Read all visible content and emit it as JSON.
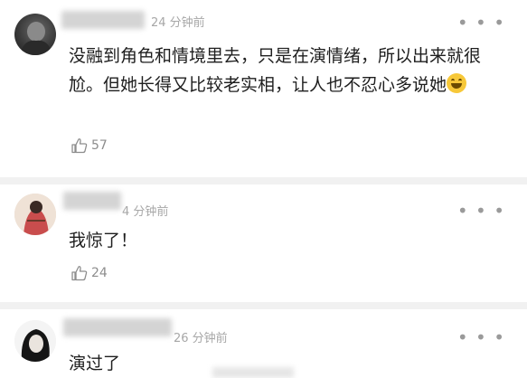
{
  "comments": [
    {
      "time": "24 分钟前",
      "more": "• • •",
      "text": "没融到角色和情境里去，只是在演情绪，所以出来就很尬。但她长得又比较老实相，让人也不忍心多说她",
      "likes": "57"
    },
    {
      "time": "4 分钟前",
      "more": "• • •",
      "text": "我惊了！",
      "likes": "24"
    },
    {
      "time": "26 分钟前",
      "more": "• • •",
      "text": "演过了",
      "likes": ""
    }
  ],
  "emoji_icon": "grinning-sweat-emoji",
  "like_icon": "thumbs-up-outline-icon"
}
